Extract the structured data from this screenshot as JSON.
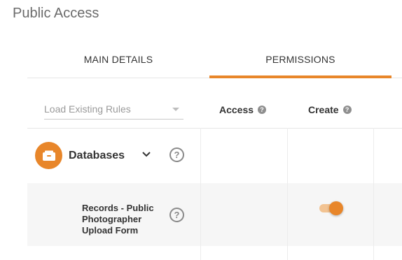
{
  "page": {
    "title": "Public Access"
  },
  "tabs": [
    {
      "label": "MAIN DETAILS",
      "active": false
    },
    {
      "label": "PERMISSIONS",
      "active": true
    }
  ],
  "rules_dropdown": {
    "placeholder": "Load Existing Rules"
  },
  "columns": [
    {
      "label": "Access",
      "help_icon": "question-icon"
    },
    {
      "label": "Create",
      "help_icon": "question-icon"
    }
  ],
  "sections": [
    {
      "label": "Databases",
      "icon": "database-icon",
      "expanded": true,
      "items": [
        {
          "label": "Records - Public Photographer Upload Form",
          "access": null,
          "create": true
        }
      ]
    }
  ],
  "colors": {
    "accent": "#e8862a",
    "toggle_track": "#f2c392"
  }
}
